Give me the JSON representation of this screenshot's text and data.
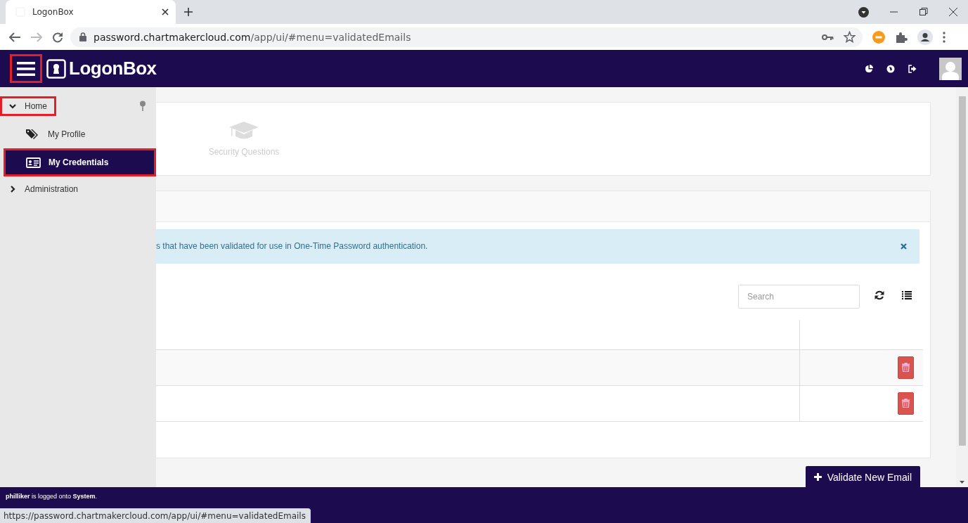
{
  "browser": {
    "tab_title": "LogonBox",
    "url_host": "password.chartmakercloud.com",
    "url_path": "/app/ui/#menu=validatedEmails"
  },
  "header": {
    "logo": "LogonBox",
    "menu_annotated": true
  },
  "sidebar": {
    "items": [
      {
        "label": "Home",
        "expanded": true,
        "annotated": true,
        "children": [
          {
            "label": "My Profile",
            "selected": false,
            "annotated": false
          },
          {
            "label": "My Credentials",
            "selected": true,
            "annotated": true
          }
        ]
      },
      {
        "label": "Administration",
        "expanded": false,
        "annotated": false
      }
    ]
  },
  "tiles": [
    {
      "label": "Security Questions"
    }
  ],
  "alert": {
    "text": "s that have been validated for use in One-Time Password authentication."
  },
  "toolbar": {
    "search_placeholder": "Search"
  },
  "table": {
    "rows": [
      {
        "kind": "deletable"
      },
      {
        "kind": "deletable"
      }
    ]
  },
  "add_button": "Validate New Email",
  "footer": {
    "status": "**philliker** is logged onto **System**."
  },
  "status_url": "https://password.chartmakercloud.com/app/ui/#menu=validatedEmails"
}
